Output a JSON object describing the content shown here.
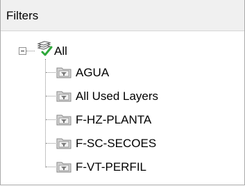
{
  "panel": {
    "title": "Filters"
  },
  "tree": {
    "root": {
      "label": "All",
      "icon": "layers-check-icon",
      "expanded": true
    },
    "items": [
      {
        "label": "AGUA",
        "icon": "filter-folder-icon"
      },
      {
        "label": "All Used Layers",
        "icon": "filter-folder-icon"
      },
      {
        "label": "F-HZ-PLANTA",
        "icon": "filter-folder-icon"
      },
      {
        "label": "F-SC-SECOES",
        "icon": "filter-folder-icon"
      },
      {
        "label": "F-VT-PERFIL",
        "icon": "filter-folder-icon"
      }
    ]
  },
  "colors": {
    "header_bg": "#f0f0f0",
    "border": "#aaaaaa",
    "check_green": "#2ea83a",
    "folder_gray": "#9a9a9a"
  }
}
